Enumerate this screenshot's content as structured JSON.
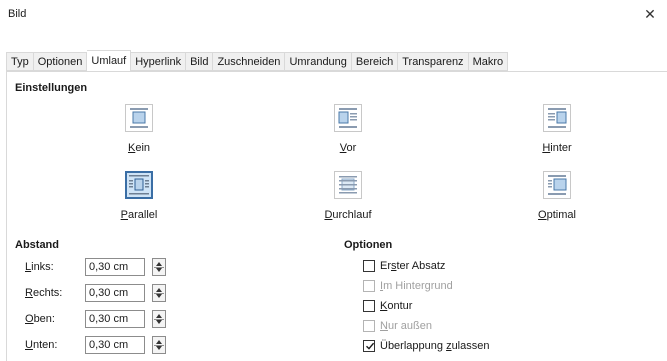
{
  "window": {
    "title": "Bild",
    "close_glyph": "✕"
  },
  "tabs": [
    {
      "label": "Typ",
      "active": false
    },
    {
      "label": "Optionen",
      "active": false
    },
    {
      "label": "Umlauf",
      "active": true
    },
    {
      "label": "Hyperlink",
      "active": false
    },
    {
      "label": "Bild",
      "active": false
    },
    {
      "label": "Zuschneiden",
      "active": false
    },
    {
      "label": "Umrandung",
      "active": false
    },
    {
      "label": "Bereich",
      "active": false
    },
    {
      "label": "Transparenz",
      "active": false
    },
    {
      "label": "Makro",
      "active": false
    }
  ],
  "einstellungen": {
    "title": "Einstellungen",
    "options": [
      {
        "label": "Kein",
        "access_key": "K",
        "rest": "ein",
        "icon": "wrap-none-icon",
        "selected": false
      },
      {
        "label": "Vor",
        "access_key": "V",
        "rest": "or",
        "icon": "wrap-before-icon",
        "selected": false
      },
      {
        "label": "Hinter",
        "access_key": "H",
        "rest": "inter",
        "icon": "wrap-after-icon",
        "selected": false
      },
      {
        "label": "Parallel",
        "access_key": "P",
        "rest": "arallel",
        "icon": "wrap-parallel-icon",
        "selected": true
      },
      {
        "label": "Durchlauf",
        "access_key": "D",
        "rest": "urchlauf",
        "icon": "wrap-through-icon",
        "selected": false
      },
      {
        "label": "Optimal",
        "access_key": "O",
        "rest": "ptimal",
        "icon": "wrap-optimal-icon",
        "selected": false
      }
    ]
  },
  "abstand": {
    "title": "Abstand",
    "fields": [
      {
        "label": "Links:",
        "access_key": "L",
        "rest": "inks:",
        "value": "0,30 cm"
      },
      {
        "label": "Rechts:",
        "access_key": "R",
        "rest": "echts:",
        "value": "0,30 cm"
      },
      {
        "label": "Oben:",
        "access_key": "O",
        "rest": "ben:",
        "value": "0,30 cm"
      },
      {
        "label": "Unten:",
        "access_key": "U",
        "rest": "nten:",
        "value": "0,30 cm"
      }
    ]
  },
  "optionen": {
    "title": "Optionen",
    "items": [
      {
        "pre": "Er",
        "key": "s",
        "post": "ter Absatz",
        "label": "Erster Absatz",
        "checked": false,
        "disabled": false
      },
      {
        "pre": "",
        "key": "I",
        "post": "m Hintergrund",
        "label": "Im Hintergrund",
        "checked": false,
        "disabled": true
      },
      {
        "pre": "",
        "key": "K",
        "post": "ontur",
        "label": "Kontur",
        "checked": false,
        "disabled": false
      },
      {
        "pre": "",
        "key": "N",
        "post": "ur außen",
        "label": "Nur außen",
        "checked": false,
        "disabled": true
      },
      {
        "pre": "Überlappung ",
        "key": "z",
        "post": "ulassen",
        "label": "Überlappung zulassen",
        "checked": true,
        "disabled": false
      }
    ]
  },
  "colors": {
    "accent": "#3a6ea5",
    "selected_bg": "#cfe4f7",
    "disabled_text": "#a0a0a0"
  }
}
